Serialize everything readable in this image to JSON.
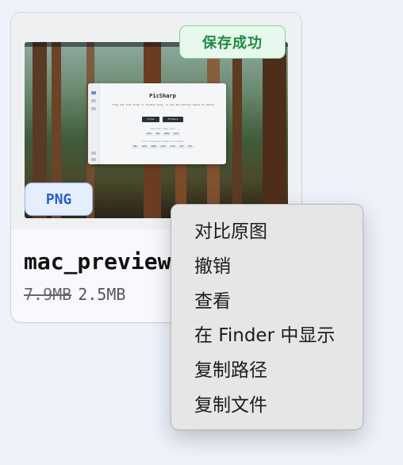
{
  "card": {
    "status_badge": "保存成功",
    "format_badge": "PNG",
    "filename": "mac_preview",
    "original_size": "7.9MB",
    "compressed_size": "2.5MB"
  },
  "preview_app": {
    "title": "PicSharp",
    "subtitle": "Drag and drop files or folders here, or use the buttons below to select",
    "buttons": [
      "Files",
      "Folders"
    ],
    "supported_label": "Supported image types",
    "types": [
      "JPEG",
      "PNG",
      "WEBP",
      "AVIF"
    ],
    "formats_label": "Local Compression Supported Formats",
    "formats": [
      "PNG",
      "JPEG",
      "WEBP",
      "AVIF",
      "TIFF",
      "GIF",
      "SVG"
    ]
  },
  "context_menu": {
    "items": [
      "对比原图",
      "撤销",
      "查看",
      "在 Finder 中显示",
      "复制路径",
      "复制文件"
    ]
  }
}
